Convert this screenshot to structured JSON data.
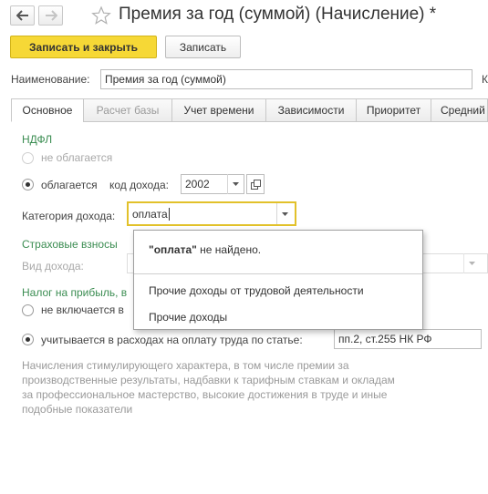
{
  "window": {
    "title": "Премия за год (суммой) (Начисление) *",
    "icons": {
      "back": "arrow-left-icon",
      "forward": "arrow-right-icon",
      "favorite": "star-icon"
    }
  },
  "toolbar": {
    "save_close_label": "Записать и закрыть",
    "save_label": "Записать"
  },
  "name_field": {
    "label": "Наименование:",
    "value": "Премия за год (суммой)",
    "next_label": "К"
  },
  "tabs": [
    {
      "label": "Основное",
      "active": true
    },
    {
      "label": "Расчет базы",
      "disabled": true
    },
    {
      "label": "Учет времени"
    },
    {
      "label": "Зависимости"
    },
    {
      "label": "Приоритет"
    },
    {
      "label": "Средний"
    }
  ],
  "ndfl": {
    "title": "НДФЛ",
    "not_taxed_label": "не облагается",
    "taxed_label": "облагается",
    "income_code_label": "код дохода:",
    "income_code_value": "2002"
  },
  "income_category": {
    "label": "Категория дохода:",
    "value": "оплата"
  },
  "insurance": {
    "title": "Страховые взносы",
    "income_type_label": "Вид дохода:"
  },
  "profit_tax": {
    "title": "Налог на прибыль, в",
    "not_included_label": "не включается в",
    "included_label": "учитывается в расходах на оплату труда по статье:",
    "article_value": "пп.2, ст.255 НК РФ"
  },
  "popup": {
    "not_found_quoted": "\"оплата\"",
    "not_found_suffix": " не найдено.",
    "items": [
      "Прочие доходы от трудовой деятельности",
      "Прочие доходы"
    ]
  },
  "description": "Начисления стимулирующего характера, в том числе премии за производственные результаты, надбавки к тарифным ставкам и окладам за профессиональное мастерство, высокие достижения в труде и иные подобные показатели",
  "colors": {
    "primary_button": "#f6d836",
    "section_title": "#3b8d52",
    "focus_border": "#e2c12a"
  }
}
